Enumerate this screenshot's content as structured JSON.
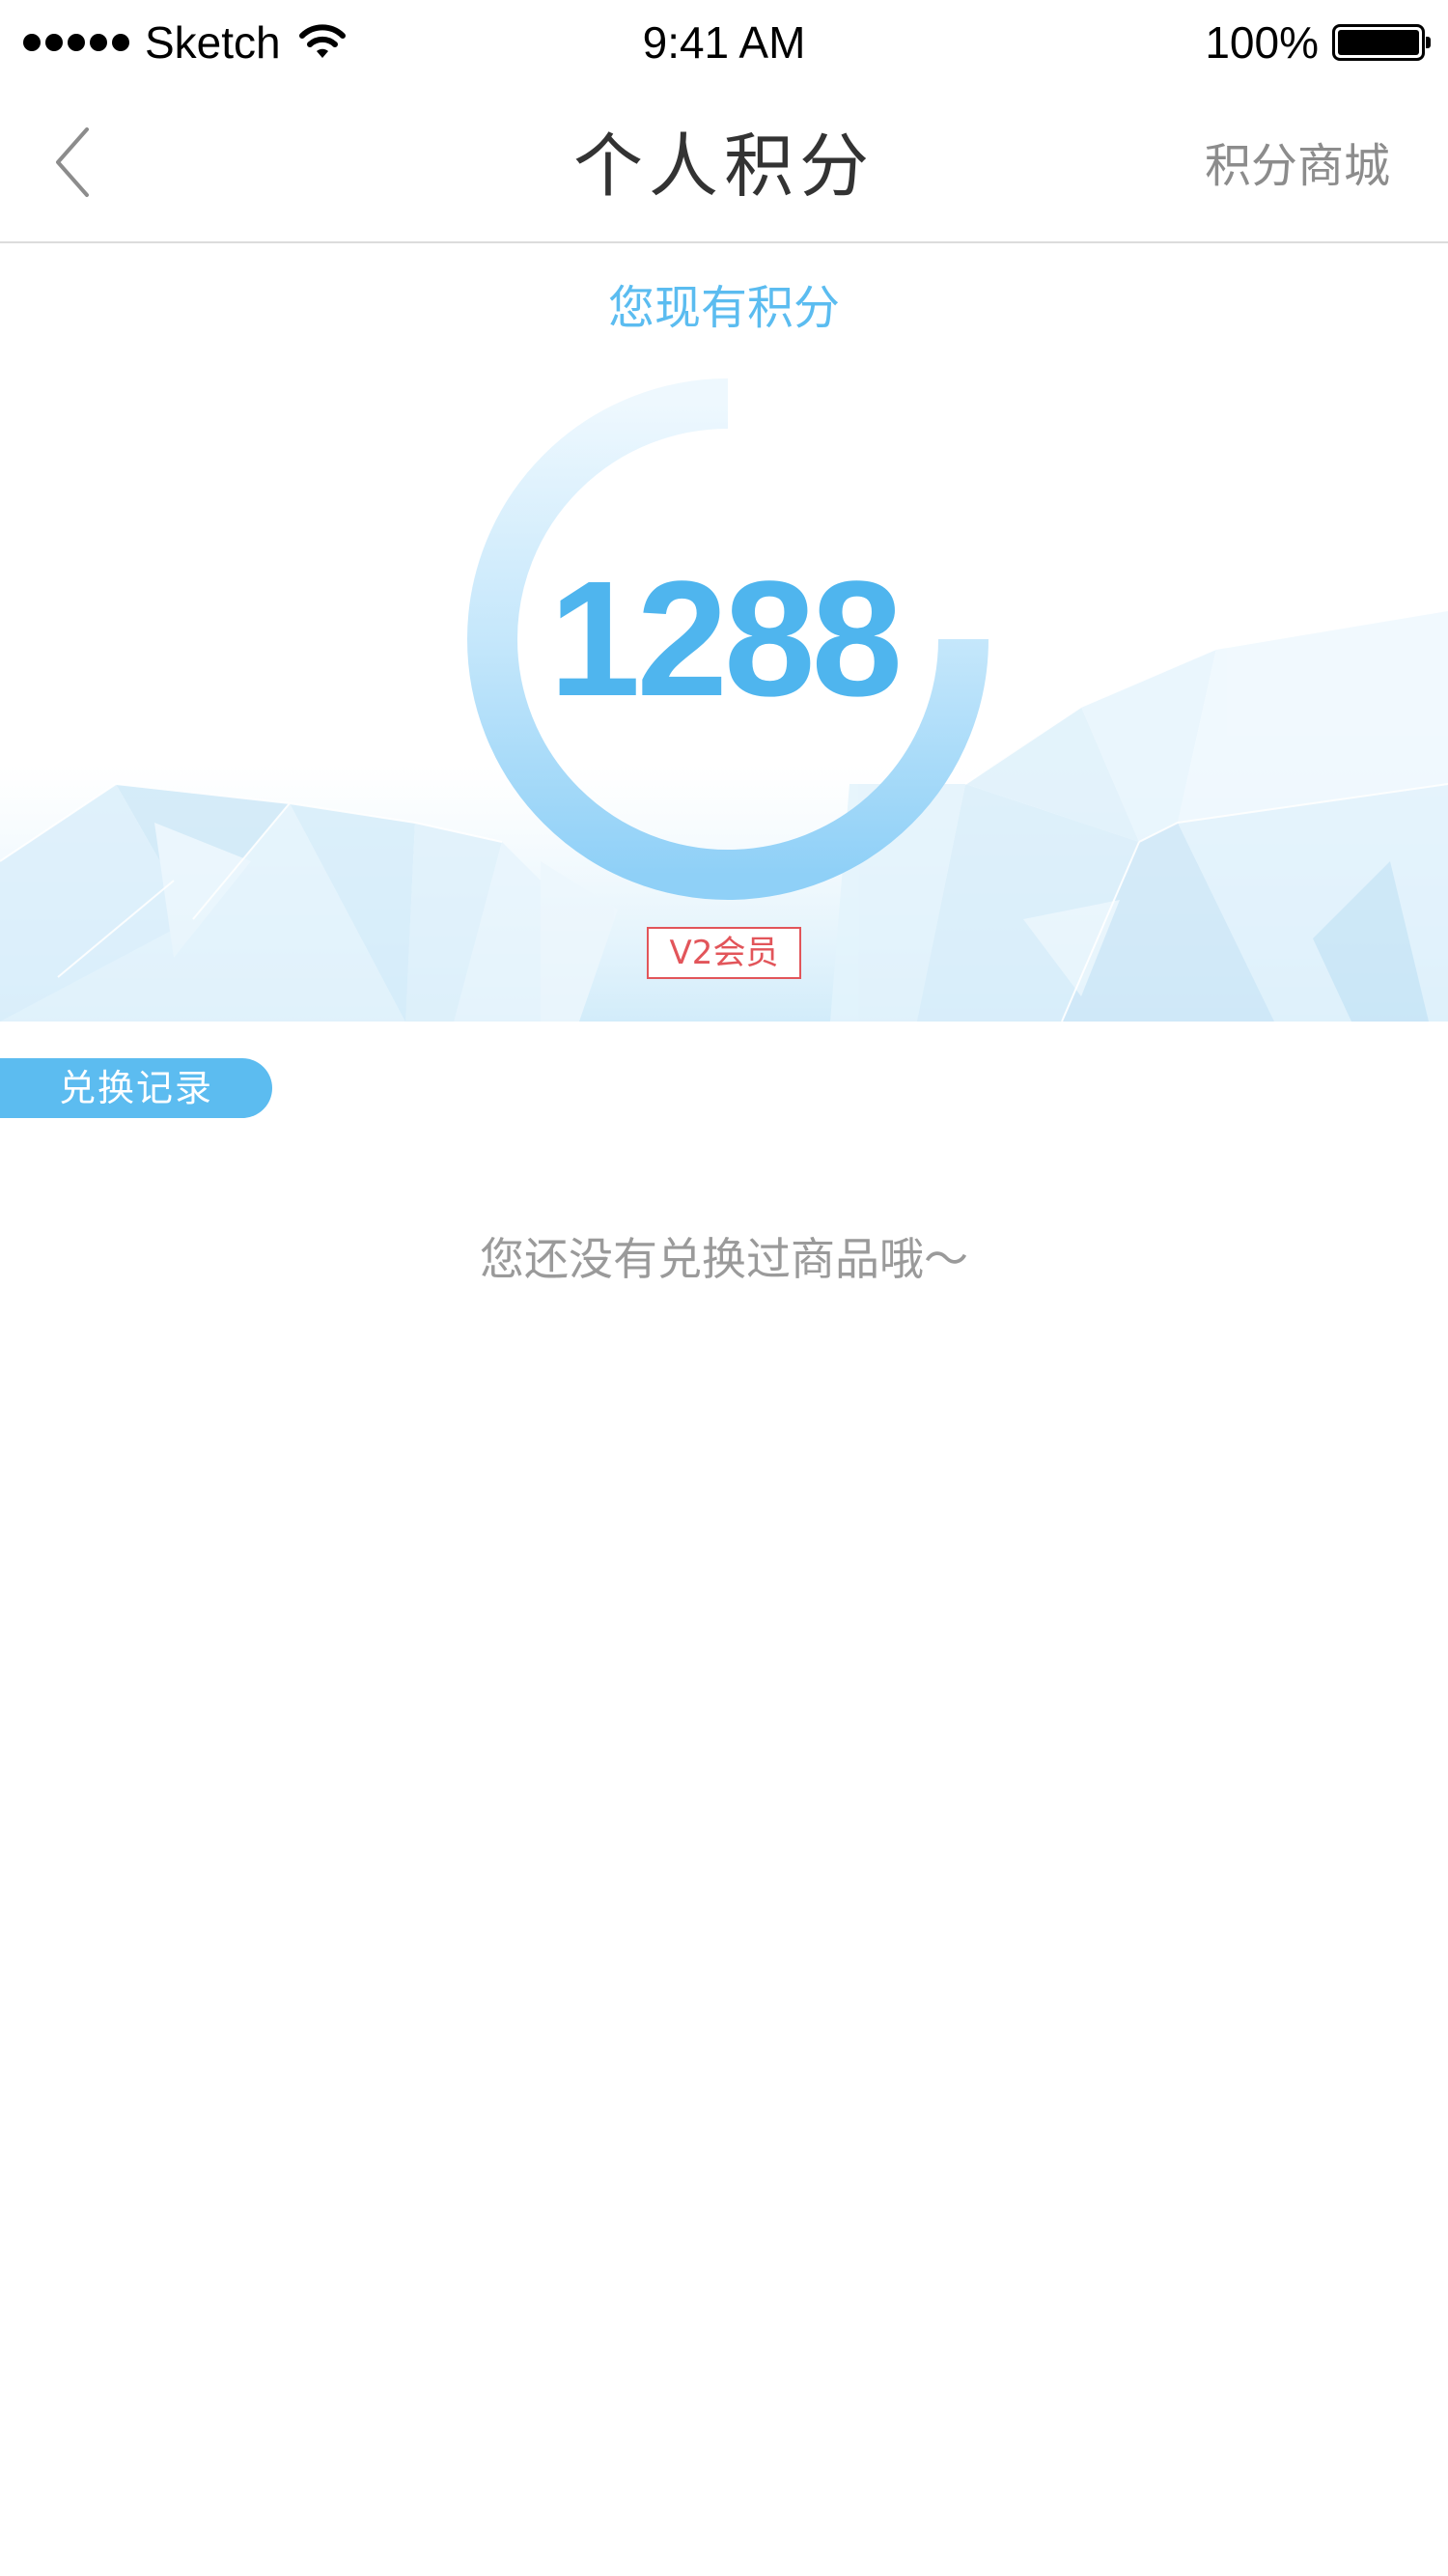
{
  "status_bar": {
    "carrier": "Sketch",
    "time": "9:41 AM",
    "battery": "100%"
  },
  "nav": {
    "title": "个人积分",
    "right_link": "积分商城"
  },
  "points": {
    "label": "您现有积分",
    "value": "1288",
    "member_level": "V2会员",
    "ring_progress_fraction": 0.75
  },
  "records": {
    "tab_label": "兑换记录",
    "empty_message": "您还没有兑换过商品哦～"
  },
  "colors": {
    "accent": "#4fb5ee",
    "badge": "#e2555a",
    "muted_text": "#9a9a9a"
  }
}
